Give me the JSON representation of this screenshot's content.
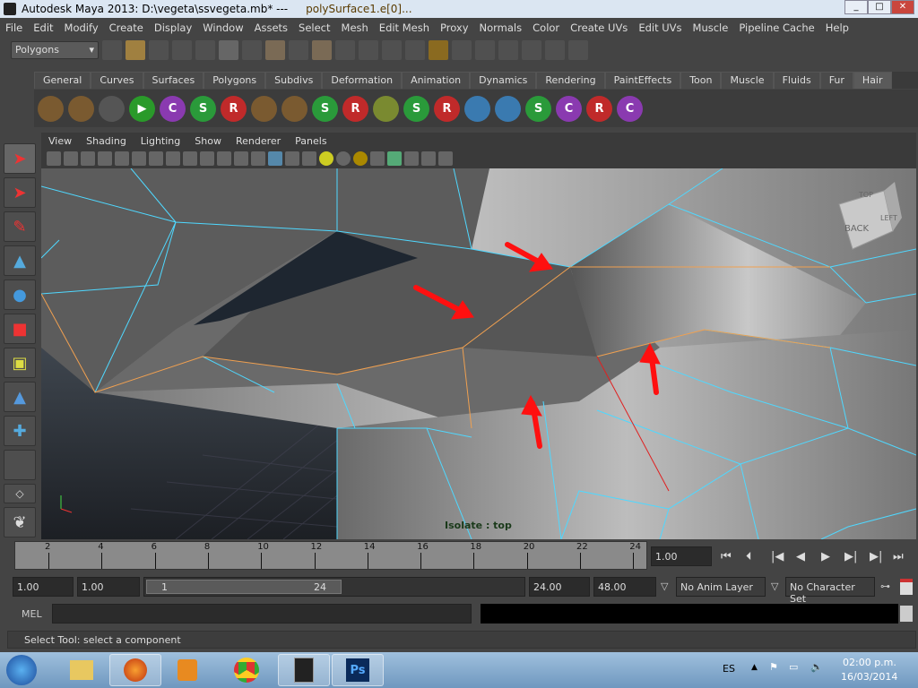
{
  "window": {
    "title": "Autodesk Maya 2013: D:\\vegeta\\ssvegeta.mb*  ---",
    "selection": "polySurface1.e[0]..."
  },
  "menu": [
    "File",
    "Edit",
    "Modify",
    "Create",
    "Display",
    "Window",
    "Assets",
    "Select",
    "Mesh",
    "Edit Mesh",
    "Proxy",
    "Normals",
    "Color",
    "Create UVs",
    "Edit UVs",
    "Muscle",
    "Pipeline Cache",
    "Help"
  ],
  "toolbar": {
    "mode_select": "Polygons"
  },
  "shelf": {
    "tabs": [
      "General",
      "Curves",
      "Surfaces",
      "Polygons",
      "Subdivs",
      "Deformation",
      "Animation",
      "Dynamics",
      "Rendering",
      "PaintEffects",
      "Toon",
      "Muscle",
      "Fluids",
      "Fur",
      "Hair"
    ],
    "active_tab": "Hair",
    "icons": [
      {
        "l": "",
        "c": "#7a5a30"
      },
      {
        "l": "",
        "c": "#7a5a30"
      },
      {
        "l": "",
        "c": "#555"
      },
      {
        "l": "▶",
        "c": "#2a9a2a"
      },
      {
        "l": "C",
        "c": "#8a3ab0"
      },
      {
        "l": "S",
        "c": "#2a9a3a"
      },
      {
        "l": "R",
        "c": "#c02a2a"
      },
      {
        "l": "",
        "c": "#7a5a30"
      },
      {
        "l": "",
        "c": "#7a5a30"
      },
      {
        "l": "S",
        "c": "#2a9a3a"
      },
      {
        "l": "R",
        "c": "#c02a2a"
      },
      {
        "l": "",
        "c": "#7a8a30"
      },
      {
        "l": "S",
        "c": "#2a9a3a"
      },
      {
        "l": "R",
        "c": "#c02a2a"
      },
      {
        "l": "",
        "c": "#3a7ab0"
      },
      {
        "l": "",
        "c": "#3a7ab0"
      },
      {
        "l": "S",
        "c": "#2a9a3a"
      },
      {
        "l": "C",
        "c": "#8a3ab0"
      },
      {
        "l": "R",
        "c": "#c02a2a"
      },
      {
        "l": "C",
        "c": "#8a3ab0"
      }
    ]
  },
  "viewport": {
    "menu": [
      "View",
      "Shading",
      "Lighting",
      "Show",
      "Renderer",
      "Panels"
    ],
    "hud": "Isolate : top",
    "viewcube": [
      "BACK",
      "LEFT",
      "TOP"
    ],
    "colors": {
      "edge": "#4fd8ff",
      "selected_edge": "#f0a050",
      "annotation": "#ff1010"
    }
  },
  "timeline": {
    "ticks": [
      "2",
      "4",
      "6",
      "8",
      "10",
      "12",
      "14",
      "16",
      "18",
      "20",
      "22",
      "24"
    ],
    "current_time": "1.00"
  },
  "range": {
    "start": "1.00",
    "playback_start": "1.00",
    "slider_start": "1",
    "slider_end": "24",
    "playback_end": "24.00",
    "end": "48.00",
    "anim_layer": "No Anim Layer",
    "character_set": "No Character Set"
  },
  "command": {
    "label": "MEL"
  },
  "status": "Select Tool: select a component",
  "taskbar": {
    "language": "ES",
    "time": "02:00 p.m.",
    "date": "16/03/2014"
  }
}
